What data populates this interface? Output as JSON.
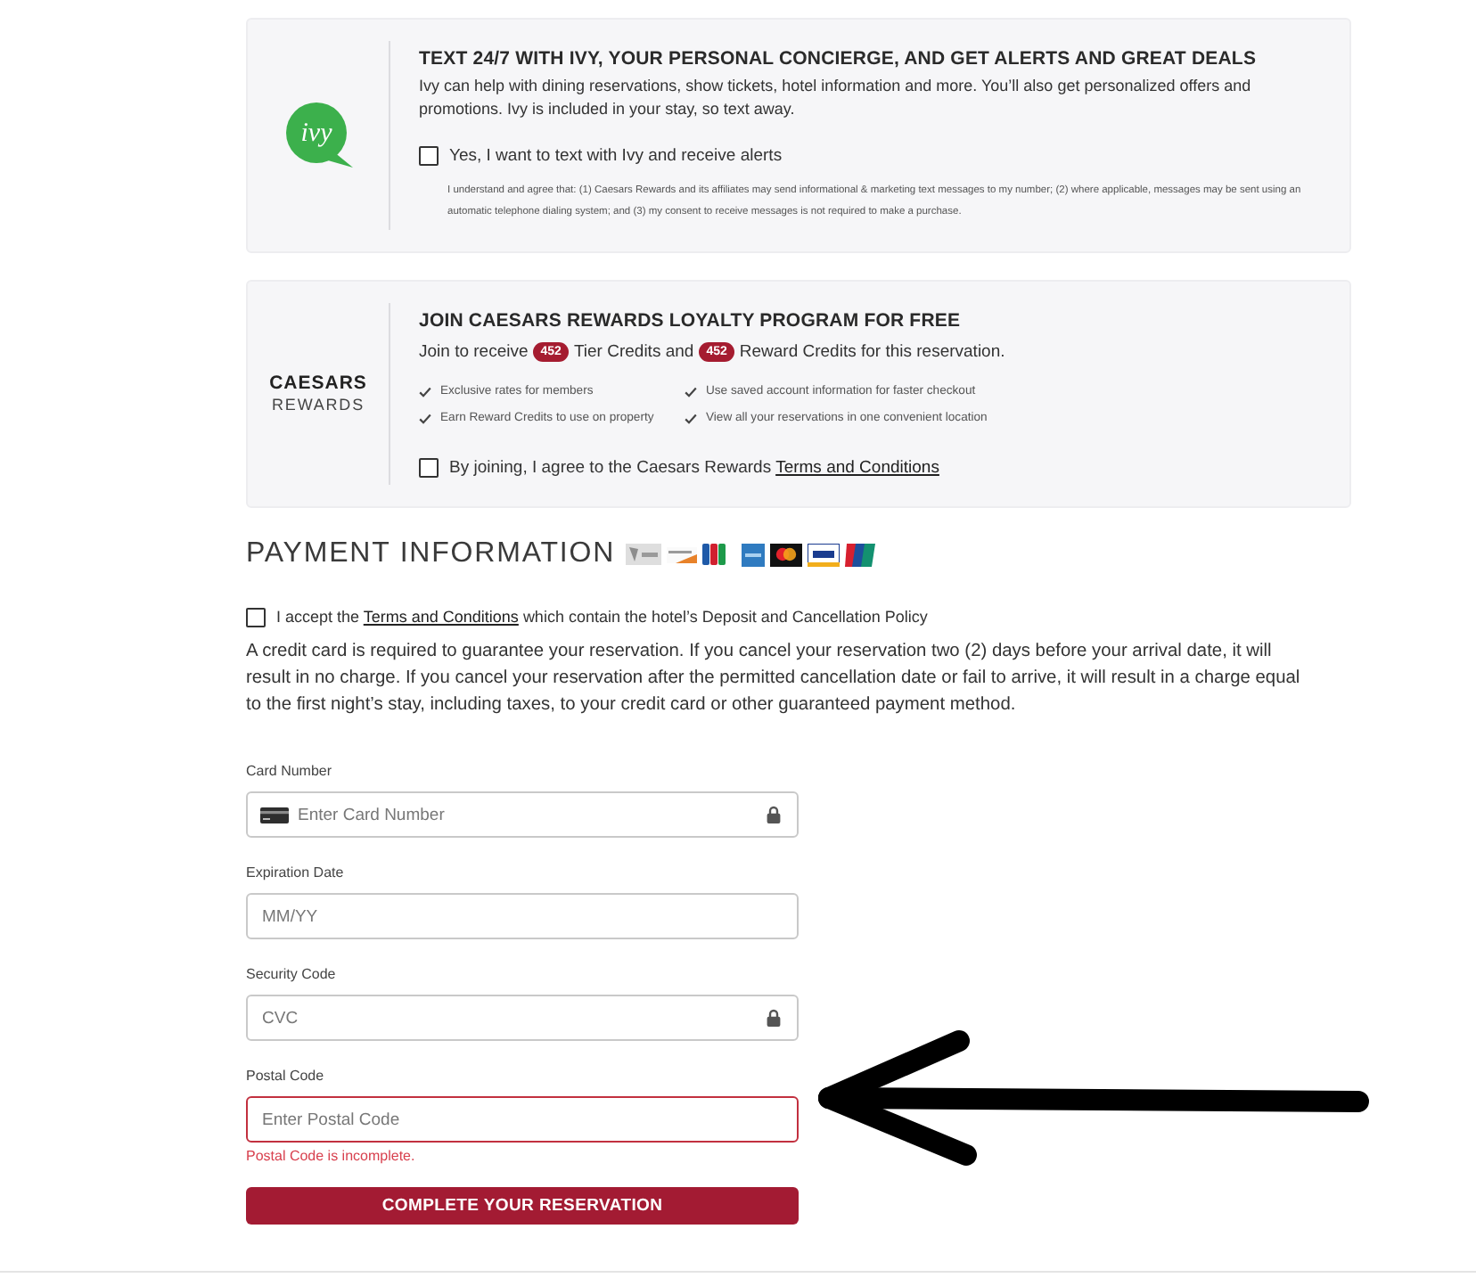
{
  "ivy_card": {
    "logo": "ivy",
    "title": "TEXT 24/7 WITH IVY, YOUR PERSONAL CONCIERGE, AND GET ALERTS AND GREAT DEALS",
    "description": "Ivy can help with dining reservations, show tickets, hotel information and more. You’ll also get personalized offers and promotions. Ivy is included in your stay, so text away.",
    "opt_in": {
      "label": "Yes, I want to text with Ivy and receive alerts",
      "checked": false
    },
    "disclaimer": "I understand and agree that: (1) Caesars Rewards and its affiliates may send informational & marketing text messages to my number; (2) where applicable, messages may be sent using an automatic telephone dialing system; and (3) my consent to receive messages is not required to make a purchase."
  },
  "rewards_card": {
    "logo": [
      "CAESARS",
      "REWARDS"
    ],
    "title": "JOIN CAESARS REWARDS LOYALTY PROGRAM FOR FREE",
    "offer": [
      {
        "kind": "text",
        "text": "Join to receive"
      },
      {
        "kind": "badge",
        "text": "452"
      },
      {
        "kind": "text",
        "text": "Tier Credits and"
      },
      {
        "kind": "badge",
        "text": "452"
      },
      {
        "kind": "text",
        "text": "Reward Credits for this reservation."
      }
    ],
    "benefits": [
      "Exclusive rates for members",
      "Use saved account information for faster checkout",
      "Earn Reward Credits to use on property",
      "View all your reservations in one convenient location"
    ],
    "agreement": {
      "label": "By joining, I agree to the Caesars Rewards",
      "link": "Terms and Conditions",
      "checked": false
    }
  },
  "payment": {
    "heading": "PAYMENT INFORMATION",
    "terms": {
      "before": "I accept the",
      "link": "Terms and Conditions",
      "after": "which contain the hotel’s Deposit and Cancellation Policy",
      "checked": false
    },
    "policy": "A credit card is required to guarantee your reservation. If you cancel your reservation two (2) days before your arrival date, it will result in no charge. If you cancel your reservation after the permitted cancellation date or fail to arrive, it will result in a charge equal to the first night’s stay, including taxes, to your credit card or other guaranteed payment method.",
    "fields": [
      {
        "kind": "card",
        "label": "Card Number",
        "placeholder": "Enter Card Number",
        "invalid": false
      },
      {
        "kind": "plain",
        "label": "Expiration Date",
        "placeholder": "MM/YY",
        "invalid": false
      },
      {
        "kind": "secure",
        "label": "Security Code",
        "placeholder": "CVC",
        "invalid": false
      },
      {
        "kind": "plain",
        "label": "Postal Code",
        "placeholder": "Enter Postal Code",
        "invalid": true,
        "error": "Postal Code is incomplete."
      }
    ],
    "submit": "COMPLETE YOUR RESERVATION"
  }
}
